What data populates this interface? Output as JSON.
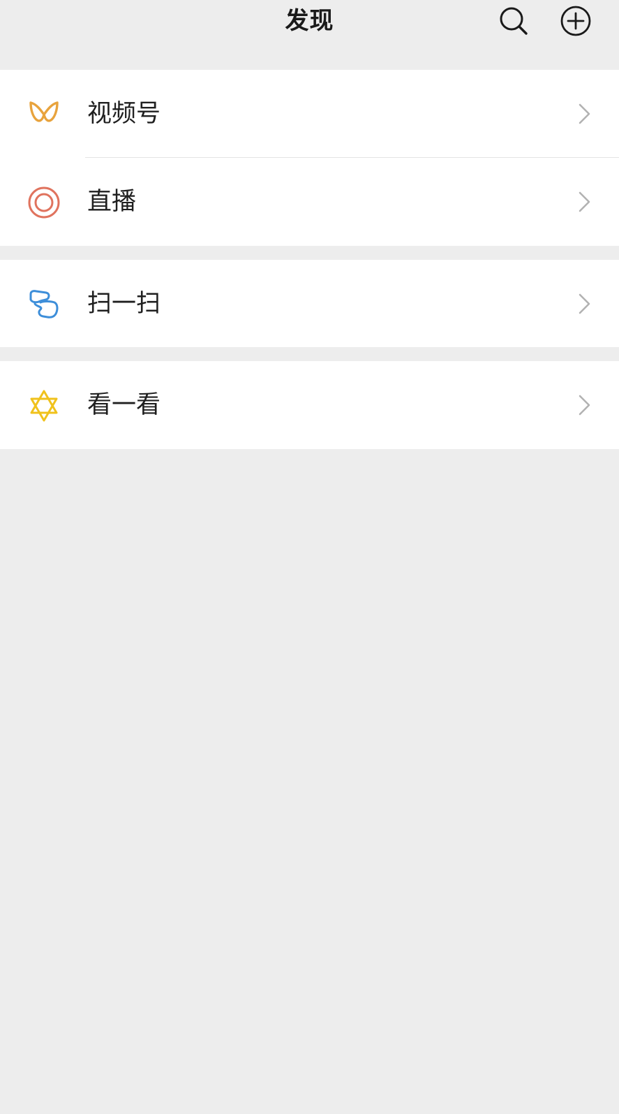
{
  "header": {
    "title": "发现",
    "search_icon": "search-icon",
    "add_icon": "plus-circle-icon"
  },
  "menu": {
    "groups": [
      {
        "items": [
          {
            "label": "视频号",
            "icon": "channels-icon",
            "icon_color": "#e8a33d"
          },
          {
            "label": "直播",
            "icon": "live-icon",
            "icon_color": "#e0735e"
          }
        ]
      },
      {
        "items": [
          {
            "label": "扫一扫",
            "icon": "scan-icon",
            "icon_color": "#3d8ed9"
          }
        ]
      },
      {
        "items": [
          {
            "label": "看一看",
            "icon": "top-stories-icon",
            "icon_color": "#f0c21c"
          }
        ]
      }
    ]
  },
  "colors": {
    "background": "#ededed",
    "card": "#ffffff",
    "chevron": "#b2b2b2",
    "divider": "#e3e3e3"
  }
}
